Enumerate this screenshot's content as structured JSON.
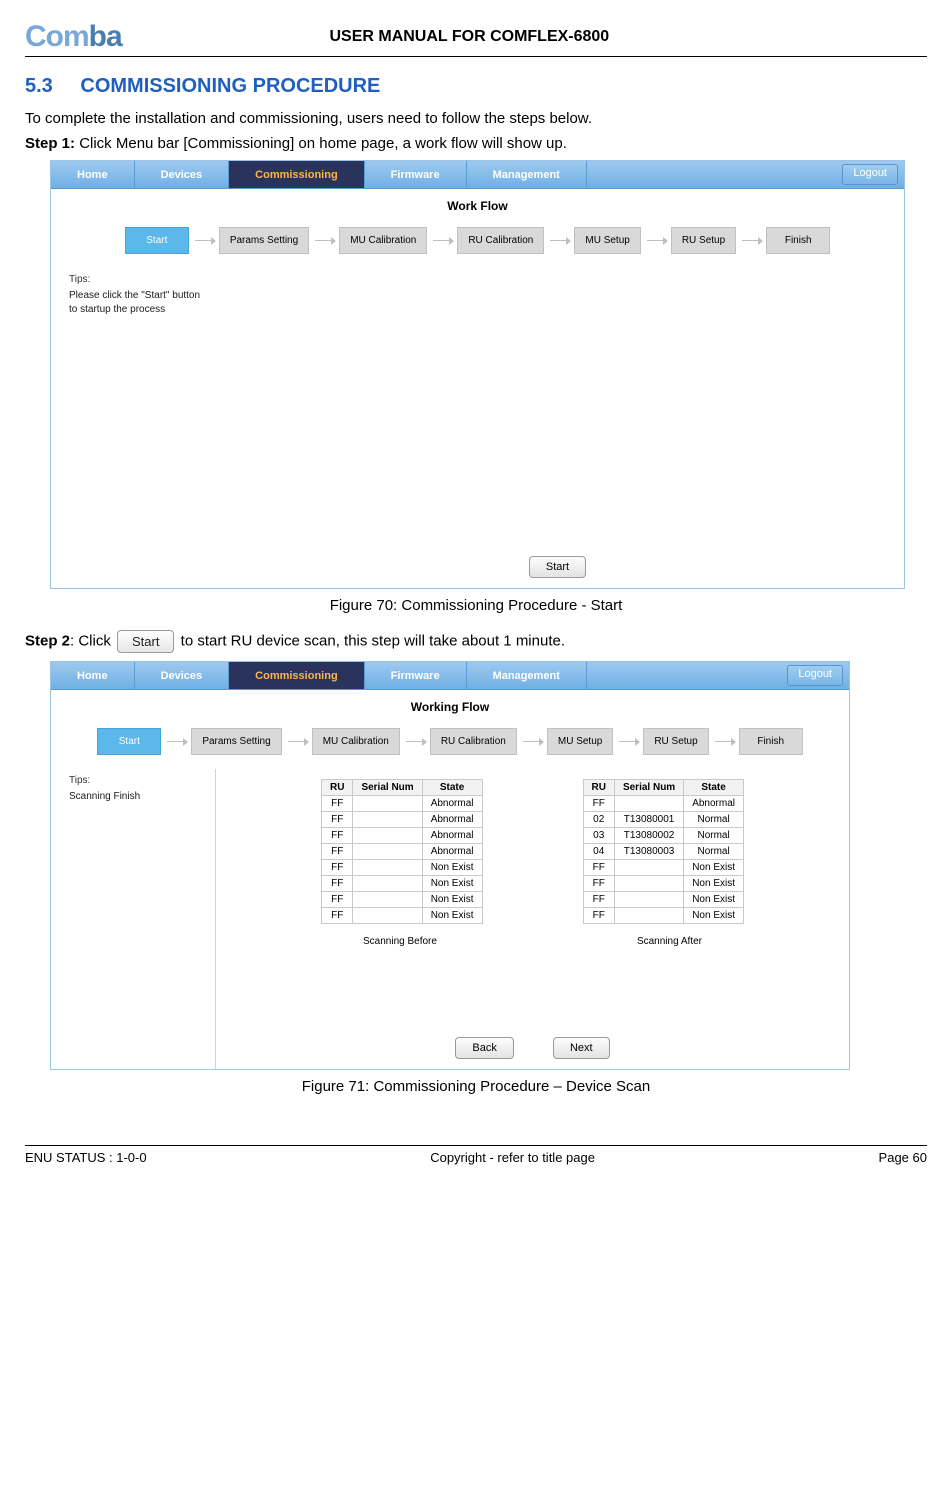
{
  "header": {
    "logo_text": "Comba",
    "title": "USER MANUAL FOR COMFLEX-6800"
  },
  "section": {
    "num": "5.3",
    "title": "COMMISSIONING PROCEDURE"
  },
  "intro": "To complete the installation and commissioning, users need to follow the steps below.",
  "step1": {
    "label": "Step 1:",
    "text": " Click Menu bar [Commissioning] on home page, a work flow will show up."
  },
  "ss1": {
    "menu": {
      "home": "Home",
      "devices": "Devices",
      "commissioning": "Commissioning",
      "firmware": "Firmware",
      "management": "Management",
      "logout": "Logout"
    },
    "wf_title": "Work Flow",
    "flow": [
      "Start",
      "Params Setting",
      "MU Calibration",
      "RU Calibration",
      "MU Setup",
      "RU Setup",
      "Finish"
    ],
    "tips_title": "Tips:",
    "tips_text": "Please click the \"Start\" button to startup the process",
    "start_btn": "Start"
  },
  "fig70": "Figure 70: Commissioning Procedure - Start",
  "step2": {
    "label": "Step 2",
    "mid": ": Click ",
    "btn": "Start",
    "rest": " to start RU device scan, this step will take about 1 minute."
  },
  "ss2": {
    "menu": {
      "home": "Home",
      "devices": "Devices",
      "commissioning": "Commissioning",
      "firmware": "Firmware",
      "management": "Management",
      "logout": "Logout"
    },
    "wf_title": "Working Flow",
    "flow": [
      "Start",
      "Params Setting",
      "MU Calibration",
      "RU Calibration",
      "MU Setup",
      "RU Setup",
      "Finish"
    ],
    "tips_title": "Tips:",
    "tips_text": "Scanning Finish",
    "headers": {
      "ru": "RU",
      "sn": "Serial Num",
      "state": "State"
    },
    "before": [
      {
        "ru": "FF",
        "sn": "",
        "state": "Abnormal"
      },
      {
        "ru": "FF",
        "sn": "",
        "state": "Abnormal"
      },
      {
        "ru": "FF",
        "sn": "",
        "state": "Abnormal"
      },
      {
        "ru": "FF",
        "sn": "",
        "state": "Abnormal"
      },
      {
        "ru": "FF",
        "sn": "",
        "state": "Non Exist"
      },
      {
        "ru": "FF",
        "sn": "",
        "state": "Non Exist"
      },
      {
        "ru": "FF",
        "sn": "",
        "state": "Non Exist"
      },
      {
        "ru": "FF",
        "sn": "",
        "state": "Non Exist"
      }
    ],
    "after": [
      {
        "ru": "FF",
        "sn": "",
        "state": "Abnormal"
      },
      {
        "ru": "02",
        "sn": "T13080001",
        "state": "Normal"
      },
      {
        "ru": "03",
        "sn": "T13080002",
        "state": "Normal"
      },
      {
        "ru": "04",
        "sn": "T13080003",
        "state": "Normal"
      },
      {
        "ru": "FF",
        "sn": "",
        "state": "Non Exist"
      },
      {
        "ru": "FF",
        "sn": "",
        "state": "Non Exist"
      },
      {
        "ru": "FF",
        "sn": "",
        "state": "Non Exist"
      },
      {
        "ru": "FF",
        "sn": "",
        "state": "Non Exist"
      }
    ],
    "before_label": "Scanning Before",
    "after_label": "Scanning After",
    "back_btn": "Back",
    "next_btn": "Next"
  },
  "fig71": "Figure 71: Commissioning Procedure – Device Scan",
  "footer": {
    "left": "ENU STATUS : 1-0-0",
    "center": "Copyright - refer to title page",
    "right": "Page 60"
  }
}
